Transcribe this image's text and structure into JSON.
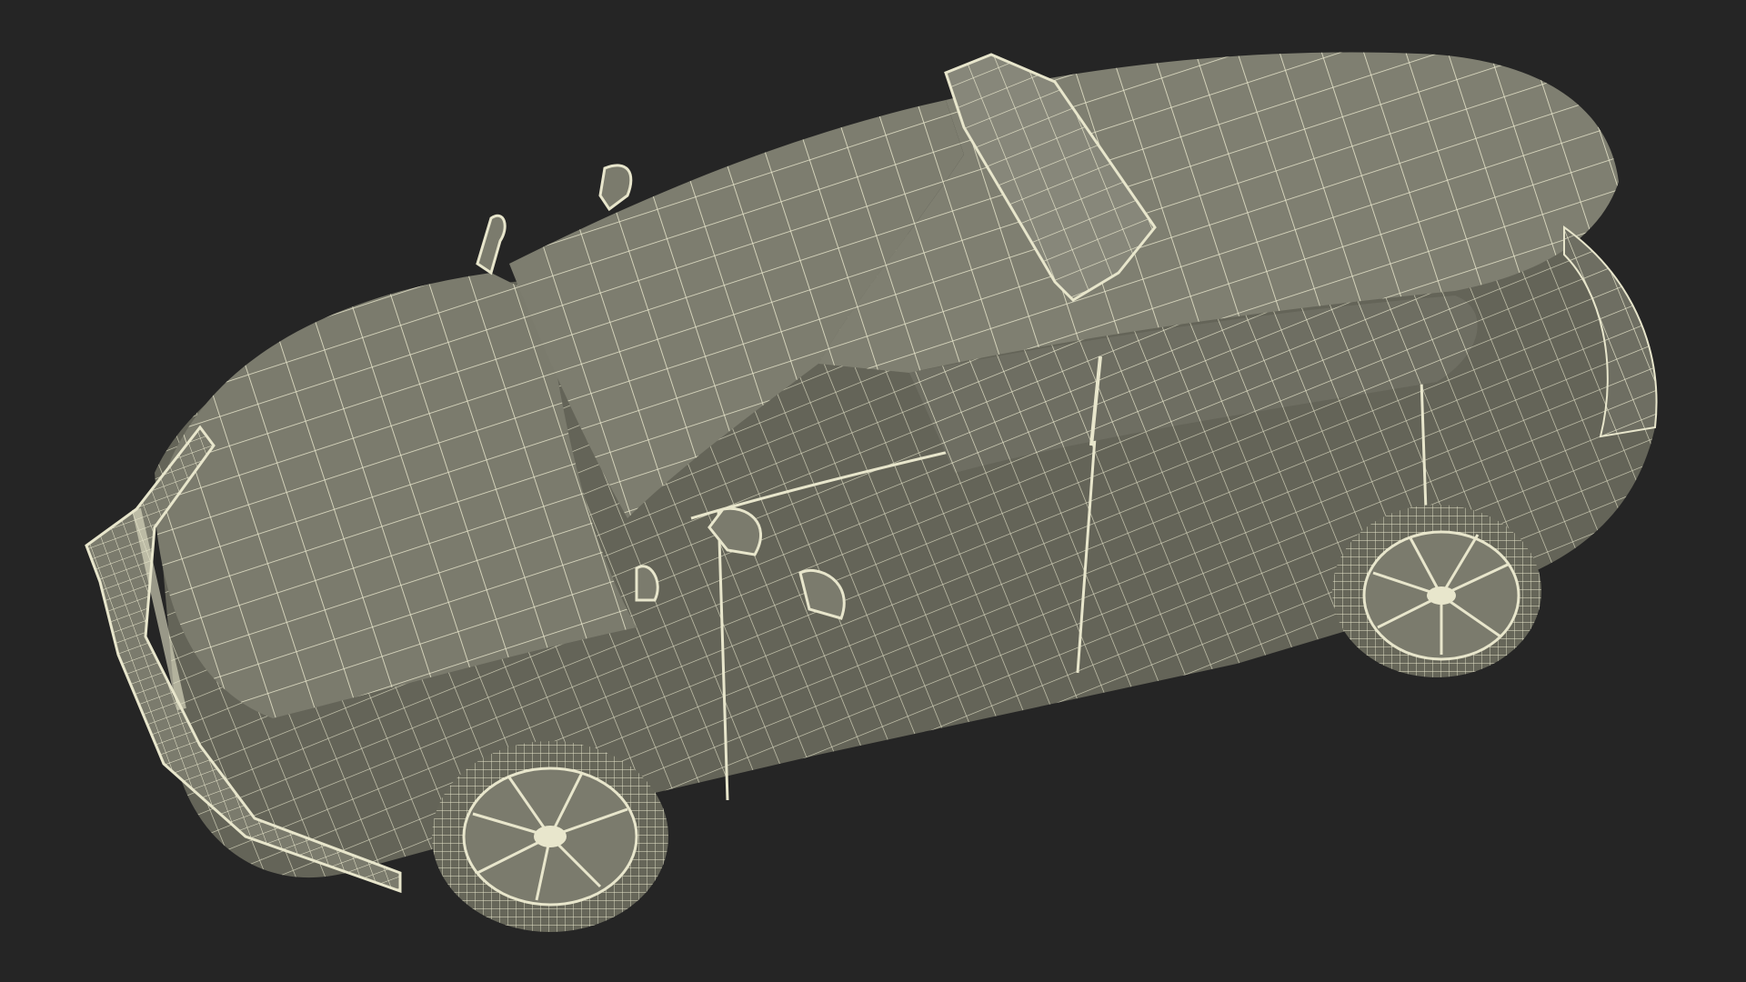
{
  "scene": {
    "background_color": "#252525",
    "surface_color": "#7b7b6d",
    "surface_shadow_color": "#5f5f54",
    "wire_color": "#e8e6cc",
    "subject": "police-car-wireframe-render"
  }
}
